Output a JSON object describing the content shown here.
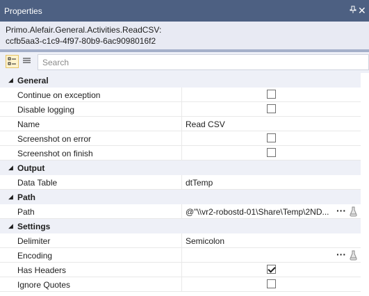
{
  "window": {
    "title": "Properties",
    "pin_glyph": "Ͱ",
    "close_glyph": "✕"
  },
  "description": {
    "line1": "Primo.Alefair.General.Activities.ReadCSV:",
    "line2": "ccfb5aa3-c1c9-4f97-80b9-6ac9098016f2"
  },
  "toolbar": {
    "categorized_icon": "categorized-view-icon",
    "alphabetical_icon": "alphabetical-view-icon",
    "search_placeholder": "Search"
  },
  "colors": {
    "titlebar": "#4d6082",
    "category_bg": "#eef0f7",
    "active_btn": "#fff3cd"
  },
  "categories": [
    {
      "label": "General",
      "props": [
        {
          "name": "Continue on exception",
          "type": "checkbox",
          "checked": false
        },
        {
          "name": "Disable logging",
          "type": "checkbox",
          "checked": false
        },
        {
          "name": "Name",
          "type": "text",
          "value": "Read CSV"
        },
        {
          "name": "Screenshot on error",
          "type": "checkbox",
          "checked": false
        },
        {
          "name": "Screenshot on finish",
          "type": "checkbox",
          "checked": false
        }
      ]
    },
    {
      "label": "Output",
      "props": [
        {
          "name": "Data Table",
          "type": "text",
          "value": "dtTemp"
        }
      ]
    },
    {
      "label": "Path",
      "props": [
        {
          "name": "Path",
          "type": "text-button",
          "value": "@\"\\\\vr2-robostd-01\\Share\\Temp\\2ND...",
          "button": "···"
        }
      ]
    },
    {
      "label": "Settings",
      "props": [
        {
          "name": "Delimiter",
          "type": "text",
          "value": "Semicolon"
        },
        {
          "name": "Encoding",
          "type": "text-button",
          "value": "",
          "button": "···"
        },
        {
          "name": "Has Headers",
          "type": "checkbox",
          "checked": true
        },
        {
          "name": "Ignore Quotes",
          "type": "checkbox",
          "checked": false
        }
      ]
    }
  ]
}
